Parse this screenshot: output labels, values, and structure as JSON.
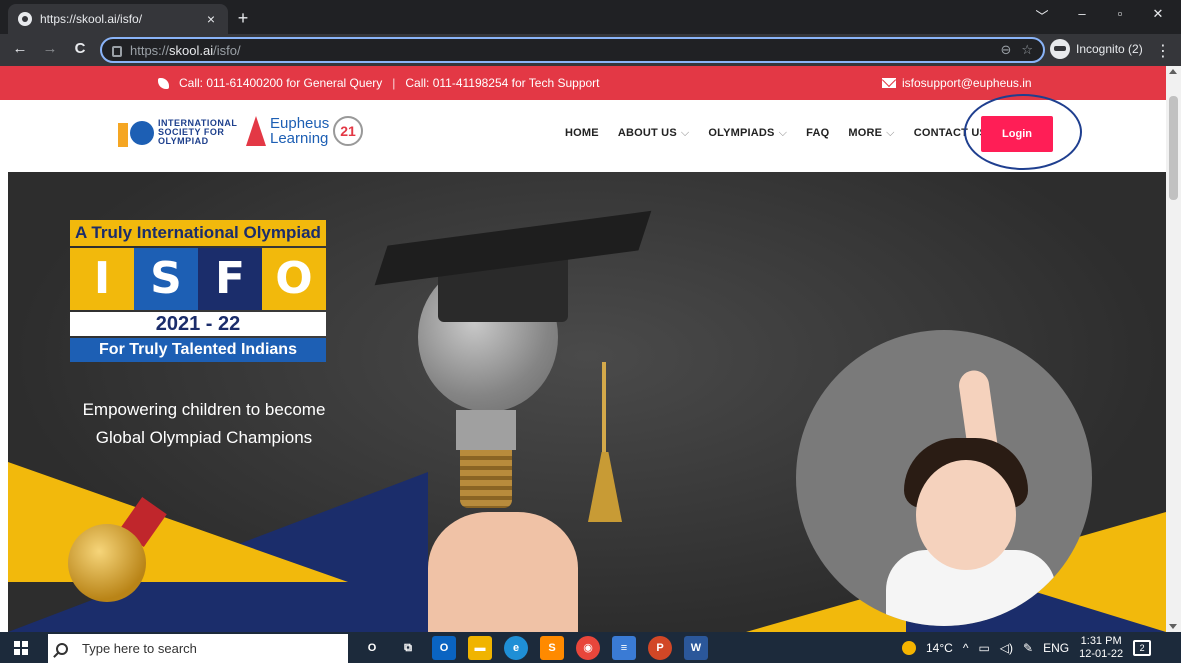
{
  "browser": {
    "tab_title": "https://skool.ai/isfo/",
    "tab_close": "×",
    "new_tab": "+",
    "url_prefix": "https://",
    "url_host": "skool.ai",
    "url_path": "/isfo/",
    "zoom_icon": "⊖",
    "star_icon": "☆",
    "incognito_label": "Incognito (2)",
    "menu_icon": "⋮",
    "back_icon": "←",
    "forward_icon": "→",
    "reload_icon": "C",
    "win_controls": [
      "﹀",
      "–",
      "▫",
      "✕"
    ]
  },
  "site": {
    "topbar": {
      "call_general": "Call: 011-61400200 for General Query",
      "separator": "|",
      "call_tech": "Call: 011-41198254 for Tech Support",
      "email": "isfosupport@eupheus.in"
    },
    "logos": {
      "isfo_line1": "INTERNATIONAL",
      "isfo_line2": "SOCIETY FOR",
      "isfo_line3": "OLYMPIAD",
      "eupheus_line1": "Eupheus",
      "eupheus_line2": "Learning",
      "badge": "21"
    },
    "nav": {
      "home": "HOME",
      "about": "ABOUT US",
      "olympiads": "OLYMPIADS",
      "faq": "FAQ",
      "more": "MORE",
      "contact": "CONTACT US",
      "chevron": "⌵"
    },
    "login_label": "Login",
    "hero": {
      "banner_top": "A Truly International Olympiad",
      "letters": [
        "I",
        "S",
        "F",
        "O"
      ],
      "year": "2021 - 22",
      "talent": "For Truly Talented Indians",
      "tagline_line1": "Empowering children to become",
      "tagline_line2": "Global Olympiad Champions"
    }
  },
  "taskbar": {
    "search_placeholder": "Type here to search",
    "apps": [
      {
        "name": "cortana",
        "glyph": "O",
        "color": "transparent"
      },
      {
        "name": "task-view",
        "glyph": "⧉",
        "color": "transparent"
      },
      {
        "name": "outlook",
        "glyph": "O",
        "color": "#0a64c2"
      },
      {
        "name": "file-explorer",
        "glyph": "▬",
        "color": "#f0b400"
      },
      {
        "name": "edge",
        "glyph": "e",
        "color": "#1f8fd6"
      },
      {
        "name": "sublime",
        "glyph": "S",
        "color": "#ff8a00"
      },
      {
        "name": "chrome",
        "glyph": "◉",
        "color": "#e8463b"
      },
      {
        "name": "notepad",
        "glyph": "≡",
        "color": "#3a7bd5"
      },
      {
        "name": "powerpoint",
        "glyph": "P",
        "color": "#d24726"
      },
      {
        "name": "word",
        "glyph": "W",
        "color": "#2b579a"
      }
    ],
    "weather": "14°C",
    "lang": "ENG",
    "time": "1:31 PM",
    "date": "12-01-22",
    "notifications": "2"
  }
}
